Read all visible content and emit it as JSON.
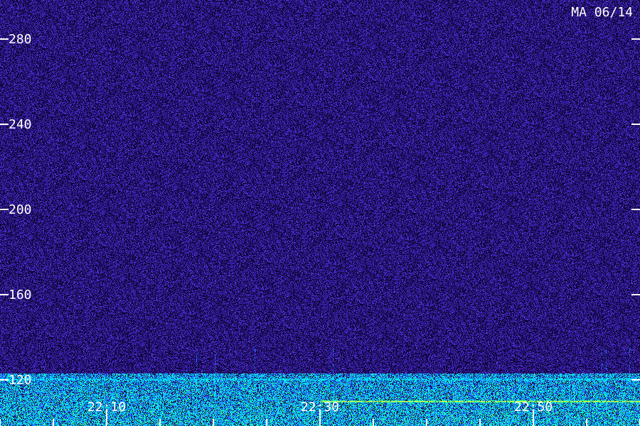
{
  "stamp": "MA 06/14",
  "colors": {
    "background": "#26106a",
    "noise_dark": "#0a0430",
    "noise_mid": "#3a20b0",
    "noise_bright": "#5a40e0",
    "signal_blue": "#1e6cff",
    "signal_cyan": "#00e0ff",
    "signal_green": "#40ff80",
    "signal_yellow": "#e8ff40",
    "axis": "#ffffff"
  },
  "chart_data": {
    "type": "heatmap",
    "title": "",
    "xlabel": "",
    "ylabel": "",
    "y_ticks": [
      {
        "value": 280,
        "label": "280"
      },
      {
        "value": 240,
        "label": "240"
      },
      {
        "value": 200,
        "label": "200"
      },
      {
        "value": 160,
        "label": "160"
      },
      {
        "value": 120,
        "label": "120"
      }
    ],
    "ylim": [
      100,
      290
    ],
    "x_ticks": [
      {
        "value": "22:10",
        "label": "22:10"
      },
      {
        "value": "22:30",
        "label": "22:30"
      },
      {
        "value": "22:50",
        "label": "22:50"
      }
    ],
    "x_minor_ticks": [
      "22:00",
      "22:05",
      "22:10",
      "22:15",
      "22:20",
      "22:25",
      "22:30",
      "22:35",
      "22:40",
      "22:45",
      "22:50",
      "22:55",
      "23:00"
    ],
    "xlim": [
      "22:00",
      "23:00"
    ],
    "grid": false,
    "legend": "none",
    "bands": [
      {
        "name": "strong band near 120",
        "y_from": 100,
        "y_to": 123,
        "intensity": "high"
      },
      {
        "name": "horizontal line",
        "y": 110,
        "x_from": "22:30",
        "x_to": "23:00",
        "intensity": "very high"
      }
    ]
  }
}
